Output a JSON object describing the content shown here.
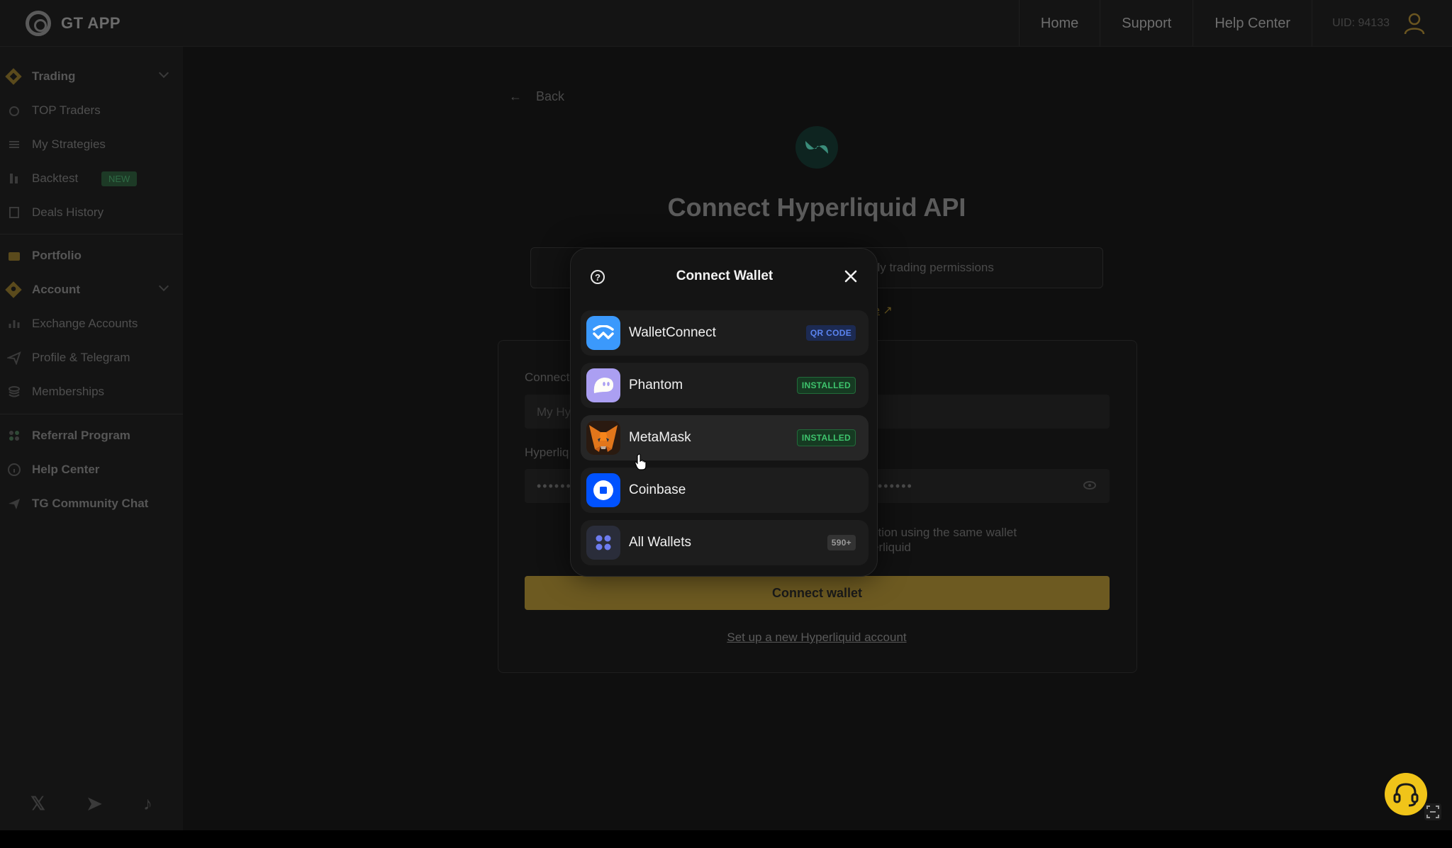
{
  "app": {
    "name": "GT APP"
  },
  "nav": {
    "home": "Home",
    "support": "Support",
    "help": "Help Center",
    "uid": "UID: 94133"
  },
  "sidebar": {
    "items": [
      {
        "label": "Trading",
        "bold": true
      },
      {
        "label": "TOP Traders"
      },
      {
        "label": "My Strategies"
      },
      {
        "label": "Backtest",
        "badge": "NEW"
      },
      {
        "label": "Deals History"
      },
      {
        "label": "Portfolio",
        "bold": true
      },
      {
        "label": "Account",
        "bold": true
      },
      {
        "label": "Exchange Accounts"
      },
      {
        "label": "Profile & Telegram"
      },
      {
        "label": "Memberships"
      },
      {
        "label": "Referral Program",
        "bold": true
      },
      {
        "label": "Help Center",
        "bold": true
      },
      {
        "label": "TG Community Chat",
        "bold": true
      }
    ]
  },
  "main": {
    "back": "Back",
    "title": "Connect Hyperliquid API",
    "info_text": "nly trading permissions",
    "link_fragment": "e",
    "label_connection": "Connect",
    "name_placeholder": "My Hy",
    "label_hyperliquid": "Hyperliq",
    "check_line1": "ction using the same wallet",
    "check_line2": "erliquid",
    "connect_button": "Connect wallet",
    "setup_link": "Set up a new Hyperliquid account"
  },
  "modal": {
    "title": "Connect Wallet",
    "wallets": [
      {
        "name": "WalletConnect",
        "tag": "QR CODE",
        "tag_type": "qr",
        "icon": "walletconnect-icon",
        "color": "#3b99fc"
      },
      {
        "name": "Phantom",
        "tag": "INSTALLED",
        "tag_type": "inst",
        "icon": "phantom-icon",
        "color": "#ab9ff2"
      },
      {
        "name": "MetaMask",
        "tag": "INSTALLED",
        "tag_type": "inst",
        "icon": "metamask-icon",
        "color": "#e2761b"
      },
      {
        "name": "Coinbase",
        "tag": "",
        "tag_type": "",
        "icon": "coinbase-icon",
        "color": "#0052ff"
      },
      {
        "name": "All Wallets",
        "tag": "590+",
        "tag_type": "count",
        "icon": "all-wallets-icon",
        "color": "#2a2d3a"
      }
    ]
  },
  "colors": {
    "accent": "#f0c419",
    "button": "#6d5a21",
    "installed": "#3ec46d"
  }
}
